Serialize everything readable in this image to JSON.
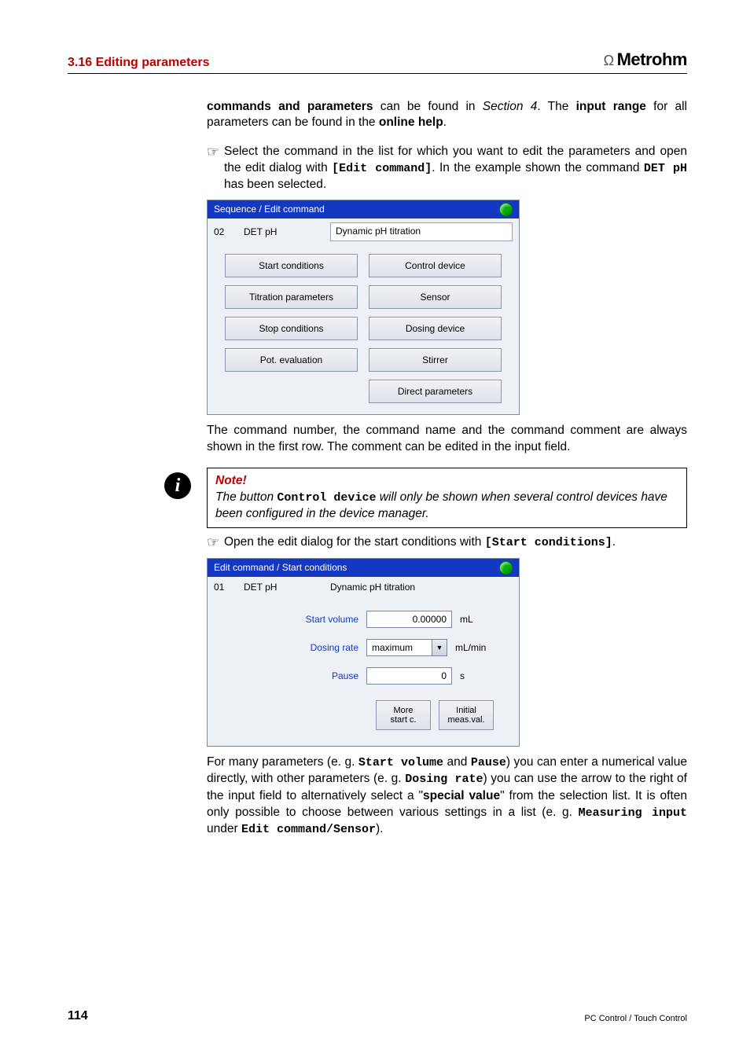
{
  "header": {
    "section": "3.16 Editing parameters",
    "brand": "Metrohm"
  },
  "intro": {
    "pre": "commands and parameters",
    "mid": " can be found in ",
    "sectRef": "Section 4",
    "post1": ". The ",
    "bold2": "input range",
    "post2": " for all parameters can be found in the ",
    "bold3": "online help",
    "period": "."
  },
  "bullet1": {
    "pre": "Select the command in the list for which you want to edit the parameters and open the edit dialog with ",
    "code1": "[Edit command]",
    "mid": ". In the example shown the command ",
    "code2": "DET pH",
    "post": " has been selected."
  },
  "panel1": {
    "title": "Sequence / Edit command",
    "num": "02",
    "name": "DET pH",
    "desc": "Dynamic pH titration",
    "buttons": [
      "Start conditions",
      "Control device",
      "Titration parameters",
      "Sensor",
      "Stop conditions",
      "Dosing device",
      "Pot. evaluation",
      "Stirrer",
      "",
      "Direct parameters"
    ]
  },
  "afterPanel1": "The command number, the command name and the command comment are always shown in the first row. The comment can be edited in the input field.",
  "note": {
    "head": "Note!",
    "pre": "The button ",
    "code": "Control device",
    "post": " will only be shown when several control devices have been configured in the device manager."
  },
  "bullet2": {
    "pre": "Open the edit dialog for the start conditions with ",
    "code": "[Start conditions]",
    "post": "."
  },
  "panel2": {
    "title": "Edit command / Start conditions",
    "num": "01",
    "name": "DET pH",
    "desc": "Dynamic pH titration",
    "rows": [
      {
        "label": "Start volume",
        "value": "0.00000",
        "type": "input",
        "unit": "mL"
      },
      {
        "label": "Dosing rate",
        "value": "maximum",
        "type": "select",
        "unit": "mL/min"
      },
      {
        "label": "Pause",
        "value": "0",
        "type": "input",
        "unit": "s"
      }
    ],
    "footer": [
      "More\nstart c.",
      "Initial\nmeas.val."
    ]
  },
  "final": {
    "t1": "For many parameters (e. g. ",
    "c1": "Start volume",
    "t2": " and ",
    "c2": "Pause",
    "t3": ") you can enter a numerical value directly, with other parameters (e. g. ",
    "c3": "Dosing rate",
    "t4": ") you can use the arrow to the right of the input field to alternatively select a \"",
    "b1": "special value",
    "t5": "\" from the selection list. It is often only possible to choose between various settings in a list (e. g. ",
    "c4": "Measuring input",
    "t6": " under ",
    "c5": "Edit command/Sensor",
    "t7": ")."
  },
  "footer": {
    "page": "114",
    "right": "PC Control / Touch Control"
  }
}
